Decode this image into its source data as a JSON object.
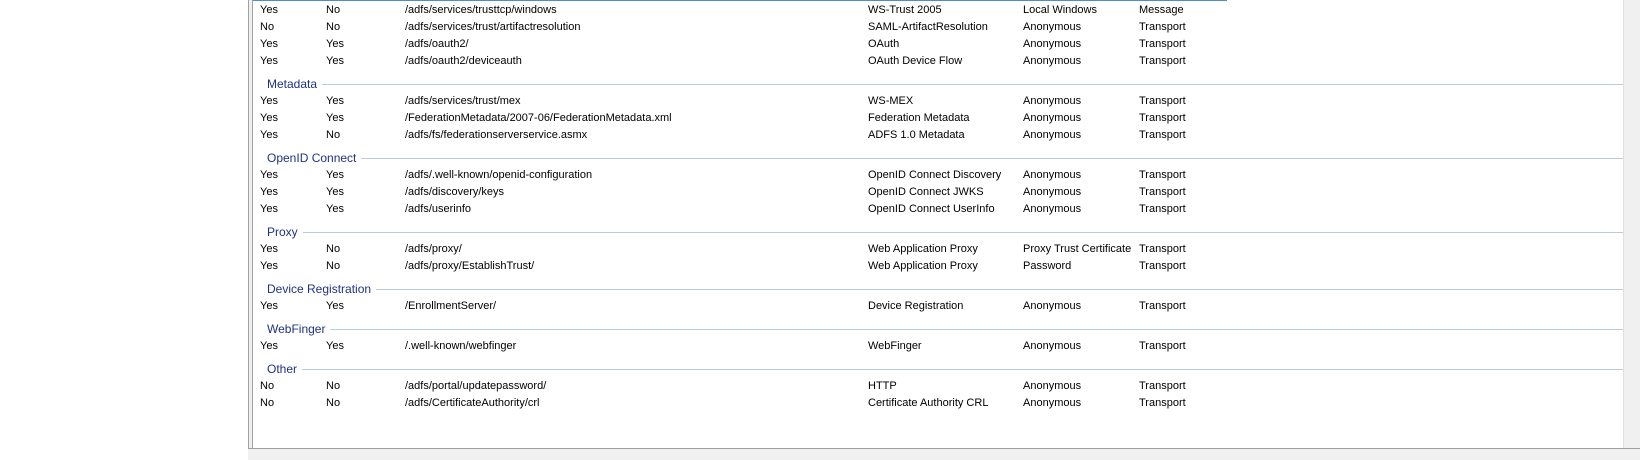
{
  "rows_top": [
    {
      "enabled": "Yes",
      "proxy": "No",
      "url": "/adfs/services/trusttcp/windows",
      "type": "WS-Trust 2005",
      "auth": "Local Windows",
      "security": "Message"
    },
    {
      "enabled": "No",
      "proxy": "No",
      "url": "/adfs/services/trust/artifactresolution",
      "type": "SAML-ArtifactResolution",
      "auth": "Anonymous",
      "security": "Transport"
    },
    {
      "enabled": "Yes",
      "proxy": "Yes",
      "url": "/adfs/oauth2/",
      "type": "OAuth",
      "auth": "Anonymous",
      "security": "Transport"
    },
    {
      "enabled": "Yes",
      "proxy": "Yes",
      "url": "/adfs/oauth2/deviceauth",
      "type": "OAuth Device Flow",
      "auth": "Anonymous",
      "security": "Transport"
    }
  ],
  "groups": [
    {
      "title": "Metadata",
      "rows": [
        {
          "enabled": "Yes",
          "proxy": "Yes",
          "url": "/adfs/services/trust/mex",
          "type": "WS-MEX",
          "auth": "Anonymous",
          "security": "Transport"
        },
        {
          "enabled": "Yes",
          "proxy": "Yes",
          "url": "/FederationMetadata/2007-06/FederationMetadata.xml",
          "type": "Federation Metadata",
          "auth": "Anonymous",
          "security": "Transport"
        },
        {
          "enabled": "Yes",
          "proxy": "No",
          "url": "/adfs/fs/federationserverservice.asmx",
          "type": "ADFS 1.0 Metadata",
          "auth": "Anonymous",
          "security": "Transport"
        }
      ]
    },
    {
      "title": "OpenID Connect",
      "rows": [
        {
          "enabled": "Yes",
          "proxy": "Yes",
          "url": "/adfs/.well-known/openid-configuration",
          "type": "OpenID Connect Discovery",
          "auth": "Anonymous",
          "security": "Transport"
        },
        {
          "enabled": "Yes",
          "proxy": "Yes",
          "url": "/adfs/discovery/keys",
          "type": "OpenID Connect JWKS",
          "auth": "Anonymous",
          "security": "Transport"
        },
        {
          "enabled": "Yes",
          "proxy": "Yes",
          "url": "/adfs/userinfo",
          "type": "OpenID Connect UserInfo",
          "auth": "Anonymous",
          "security": "Transport"
        }
      ]
    },
    {
      "title": "Proxy",
      "rows": [
        {
          "enabled": "Yes",
          "proxy": "No",
          "url": "/adfs/proxy/",
          "type": "Web Application Proxy",
          "auth": "Proxy Trust Certificate",
          "security": "Transport"
        },
        {
          "enabled": "Yes",
          "proxy": "No",
          "url": "/adfs/proxy/EstablishTrust/",
          "type": "Web Application Proxy",
          "auth": "Password",
          "security": "Transport"
        }
      ]
    },
    {
      "title": "Device Registration",
      "rows": [
        {
          "enabled": "Yes",
          "proxy": "Yes",
          "url": "/EnrollmentServer/",
          "type": "Device Registration",
          "auth": "Anonymous",
          "security": "Transport"
        }
      ]
    },
    {
      "title": "WebFinger",
      "rows": [
        {
          "enabled": "Yes",
          "proxy": "Yes",
          "url": "/.well-known/webfinger",
          "type": "WebFinger",
          "auth": "Anonymous",
          "security": "Transport"
        }
      ]
    },
    {
      "title": "Other",
      "rows": [
        {
          "enabled": "No",
          "proxy": "No",
          "url": "/adfs/portal/updatepassword/",
          "type": "HTTP",
          "auth": "Anonymous",
          "security": "Transport"
        },
        {
          "enabled": "No",
          "proxy": "No",
          "url": "/adfs/CertificateAuthority/crl",
          "type": "Certificate Authority CRL",
          "auth": "Anonymous",
          "security": "Transport"
        }
      ]
    }
  ],
  "colors": {
    "group_title": "#1e3287",
    "group_rule": "#bccbd8",
    "accent_line": "#4a90c8"
  }
}
